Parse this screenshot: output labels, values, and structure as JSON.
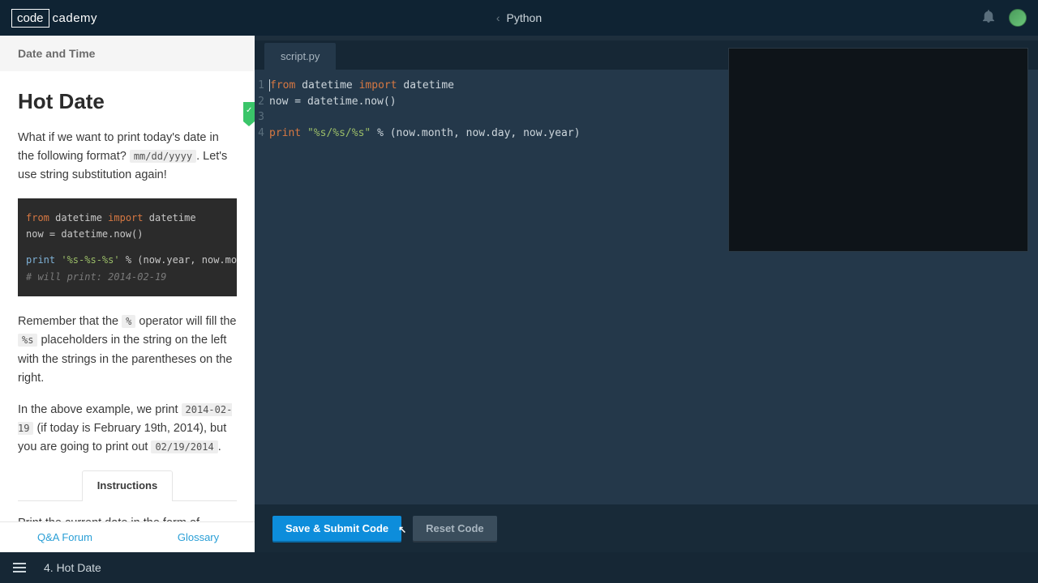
{
  "header": {
    "logo_box": "code",
    "logo_text": "cademy",
    "breadcrumb": "Python"
  },
  "sidebar": {
    "section": "Date and Time",
    "title": "Hot Date",
    "p1_a": "What if we want to print today's date in the following format? ",
    "p1_code": "mm/dd/yyyy",
    "p1_b": ". Let's use string substitution again!",
    "code_example": {
      "l1_a": "from",
      "l1_b": " datetime ",
      "l1_c": "import",
      "l1_d": " datetime",
      "l2_a": "now = datetime.now()",
      "l3_a": "print ",
      "l3_b": "'%s-%s-%s'",
      "l3_c": " % (now.year, now.month, no",
      "l4_a": "# will print: 2014-02-19"
    },
    "p2_a": "Remember that the ",
    "p2_code1": "%",
    "p2_b": " operator will fill the ",
    "p2_code2": "%s",
    "p2_c": " placeholders in the string on the left with the strings in the parentheses on the right.",
    "p3_a": "In the above example, we print ",
    "p3_code1": "2014-02-19",
    "p3_b": " (if today is February 19th, 2014), but you are going to print out ",
    "p3_code2": "02/19/2014",
    "p3_c": ".",
    "instructions_tab": "Instructions",
    "instructions_p1": "Print the current date in the form of",
    "footer_qa": "Q&A Forum",
    "footer_glossary": "Glossary"
  },
  "editor": {
    "tab": "script.py",
    "lines": [
      "1",
      "2",
      "3",
      "4"
    ],
    "code": {
      "l1": {
        "a": "from",
        "b": " datetime ",
        "c": "import",
        "d": " datetime"
      },
      "l2": "now = datetime.now()",
      "l3": "",
      "l4": {
        "a": "print",
        "b": " ",
        "c": "\"%s/%s/%s\"",
        "d": " % (now.month, now.day, now.year)"
      }
    },
    "btn_submit": "Save & Submit Code",
    "btn_reset": "Reset Code"
  },
  "bottombar": {
    "lesson": "4. Hot Date"
  }
}
